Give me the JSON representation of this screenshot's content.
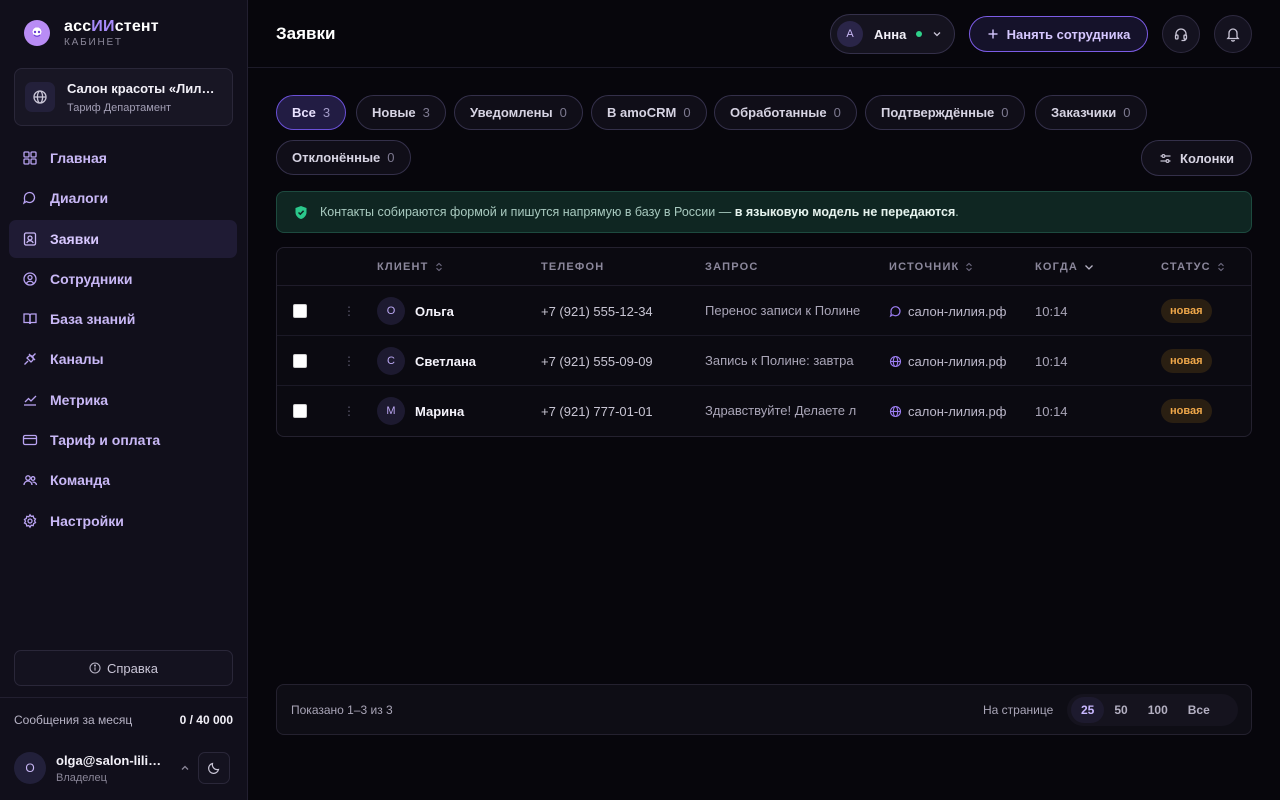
{
  "brand": {
    "name_prefix": "асс",
    "name_accent": "ИИ",
    "name_suffix": "стент",
    "subtitle": "КАБИНЕТ"
  },
  "org": {
    "name": "Салон красоты «Лилия»",
    "plan": "Тариф Департамент"
  },
  "nav": [
    {
      "label": "Главная",
      "icon": "grid-icon"
    },
    {
      "label": "Диалоги",
      "icon": "chat-icon"
    },
    {
      "label": "Заявки",
      "icon": "contact-card-icon",
      "active": true
    },
    {
      "label": "Сотрудники",
      "icon": "user-circle-icon"
    },
    {
      "label": "База знаний",
      "icon": "book-icon"
    },
    {
      "label": "Каналы",
      "icon": "plug-icon"
    },
    {
      "label": "Метрика",
      "icon": "trend-icon"
    },
    {
      "label": "Тариф и оплата",
      "icon": "credit-card-icon"
    },
    {
      "label": "Команда",
      "icon": "team-icon"
    },
    {
      "label": "Настройки",
      "icon": "gear-icon"
    }
  ],
  "help_label": "Справка",
  "usage": {
    "label": "Сообщения за месяц",
    "value": "0 / 40 000"
  },
  "user": {
    "initial": "O",
    "email": "olga@salon-liliya.rf",
    "role": "Владелец"
  },
  "header": {
    "title": "Заявки",
    "agent": {
      "initial": "А",
      "name": "Анна",
      "status": "online"
    },
    "hire_label": "Нанять сотрудника"
  },
  "filters": [
    {
      "label": "Все",
      "count": "3",
      "active": true
    },
    {
      "label": "Новые",
      "count": "3"
    },
    {
      "label": "Уведомлены",
      "count": "0"
    },
    {
      "label": "В amoCRM",
      "count": "0"
    },
    {
      "label": "Обработанные",
      "count": "0"
    },
    {
      "label": "Подтверждённые",
      "count": "0"
    },
    {
      "label": "Заказчики",
      "count": "0"
    },
    {
      "label": "Отклонённые",
      "count": "0"
    }
  ],
  "columns_label": "Колонки",
  "notice": {
    "text": "Контакты собираются формой и пишутся напрямую в базу в России — ",
    "bold": "в языковую модель не передаются",
    "end": "."
  },
  "table": {
    "headers": {
      "client": "КЛИЕНТ",
      "phone": "ТЕЛЕФОН",
      "request": "ЗАПРОС",
      "source": "ИСТОЧНИК",
      "when": "КОГДА",
      "status": "СТАТУС"
    },
    "rows": [
      {
        "initial": "О",
        "client": "Ольга",
        "phone": "+7 (921) 555-12-34",
        "request": "Перенос записи к Полине",
        "source_icon": "chat-bubble-icon",
        "source": "салон-лилия.рф",
        "when": "10:14",
        "status": "новая"
      },
      {
        "initial": "С",
        "client": "Светлана",
        "phone": "+7 (921) 555-09-09",
        "request": "Запись к Полине: завтра",
        "source_icon": "globe-icon",
        "source": "салон-лилия.рф",
        "when": "10:14",
        "status": "новая"
      },
      {
        "initial": "М",
        "client": "Марина",
        "phone": "+7 (921) 777-01-01",
        "request": "Здравствуйте! Делаете л",
        "source_icon": "globe-icon",
        "source": "салон-лилия.рф",
        "when": "10:14",
        "status": "новая"
      }
    ]
  },
  "pager": {
    "info": "Показано 1–3 из 3",
    "per_page_label": "На странице",
    "options": [
      "25",
      "50",
      "100",
      "Все"
    ],
    "selected": "25"
  },
  "colors": {
    "accent": "#a78bfa",
    "status_new": "#f0a84a",
    "online": "#2fd18a",
    "notice_bg": "#0f2622"
  }
}
